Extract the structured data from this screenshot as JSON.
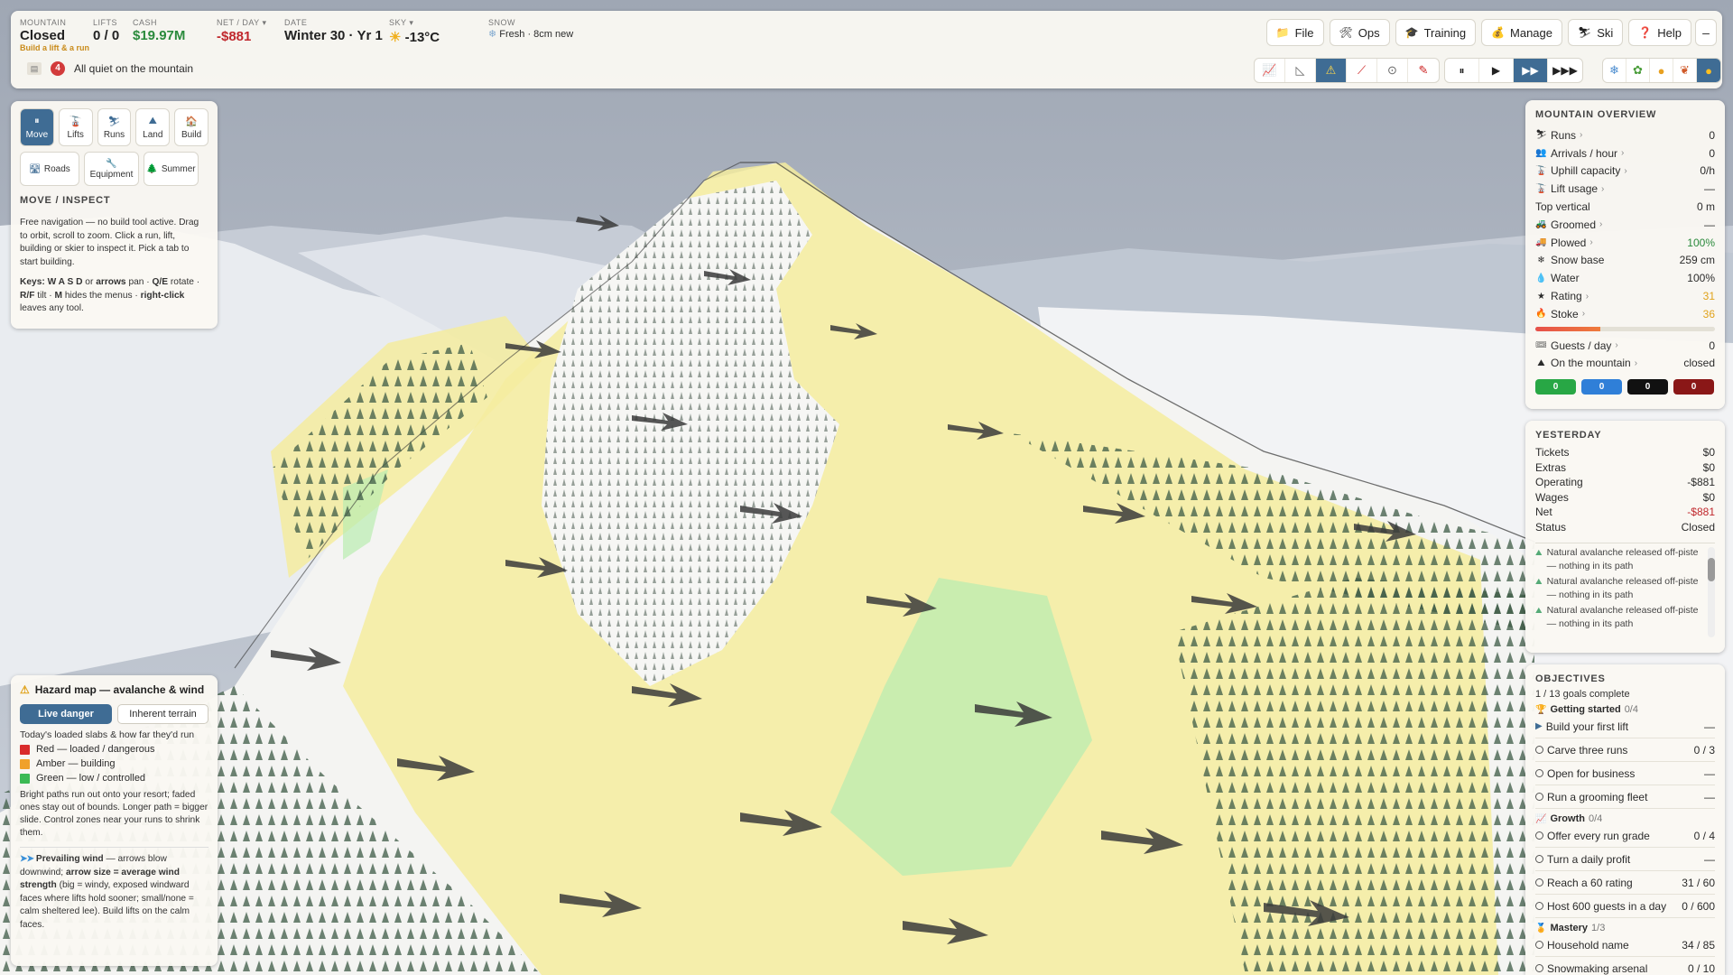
{
  "topbar": {
    "mountain_label": "MOUNTAIN",
    "mountain_value": "Closed",
    "mountain_sub": "Build a lift & a run",
    "lifts_label": "LIFTS",
    "lifts_value": "0 / 0",
    "cash_label": "CASH",
    "cash_value": "$19.97M",
    "net_label": "NET / DAY",
    "net_value": "-$881",
    "date_label": "DATE",
    "date_value": "Winter 30 · Yr 1",
    "sky_label": "SKY",
    "sky_value": "-13°C",
    "snow_label": "SNOW",
    "snow_value": "Fresh · 8cm new",
    "menu": [
      {
        "label": "File",
        "icon": "folder-icon",
        "glyph": "📁"
      },
      {
        "label": "Ops",
        "icon": "tools-icon",
        "glyph": "🛠"
      },
      {
        "label": "Training",
        "icon": "graduation-cap-icon",
        "glyph": "🎓"
      },
      {
        "label": "Manage",
        "icon": "money-bag-icon",
        "glyph": "💰"
      },
      {
        "label": "Ski",
        "icon": "skier-icon",
        "glyph": "⛷"
      },
      {
        "label": "Help",
        "icon": "question-icon",
        "glyph": "❓"
      }
    ],
    "collapse_glyph": "–",
    "ticker_count": "4",
    "ticker_text": "All quiet on the mountain"
  },
  "tools_panel": {
    "tabs": [
      {
        "label": "Move",
        "glyph": "⏸",
        "icon": "pause-icon"
      },
      {
        "label": "Lifts",
        "glyph": "🚡",
        "icon": "lift-icon"
      },
      {
        "label": "Runs",
        "glyph": "⛷",
        "icon": "skier-icon"
      },
      {
        "label": "Land",
        "glyph": "⛰",
        "icon": "mountain-icon"
      },
      {
        "label": "Build",
        "glyph": "🏠",
        "icon": "house-icon"
      }
    ],
    "tabs2": [
      {
        "label": "Roads",
        "glyph": "🛣",
        "icon": "road-icon"
      },
      {
        "label": "Equipment",
        "glyph": "🔧",
        "icon": "wrench-icon"
      },
      {
        "label": "Summer",
        "glyph": "🌲",
        "icon": "tree-icon"
      }
    ],
    "heading": "MOVE / INSPECT",
    "description": "Free navigation — no build tool active. Drag to orbit, scroll to zoom. Click a run, lift, building or skier to inspect it. Pick a tab to start building.",
    "keys_prefix": "Keys:",
    "keys_wasd": "W A S D",
    "keys_or": " or ",
    "keys_arrows": "arrows",
    "keys_pan": " pan · ",
    "keys_qe": "Q/E",
    "keys_rotate": " rotate · ",
    "keys_rf": "R/F",
    "keys_tilt": " tilt · ",
    "keys_m": "M",
    "keys_hides": " hides the menus · ",
    "keys_right": "right-click",
    "keys_leaves": " leaves any tool."
  },
  "hazard": {
    "title": "Hazard map — avalanche & wind",
    "toggle_live": "Live danger",
    "toggle_inherent": "Inherent terrain",
    "subtitle": "Today's loaded slabs & how far they'd run",
    "legend": [
      {
        "label": "Red — loaded / dangerous",
        "color": "#d92b2b"
      },
      {
        "label": "Amber — building",
        "color": "#f0a12a"
      },
      {
        "label": "Green — low / controlled",
        "color": "#3cba55"
      }
    ],
    "paragraph": "Bright paths run out onto your resort; faded ones stay out of bounds. Longer path = bigger slide. Control zones near your runs to shrink them.",
    "wind_glyph": "➤➤",
    "wind_bold": "Prevailing wind",
    "wind_text1": " — arrows blow downwind; ",
    "wind_bold2": "arrow size = average wind strength",
    "wind_text2": " (big = windy, exposed windward faces where lifts hold sooner; small/none = calm sheltered lee). Build lifts on the calm faces."
  },
  "overview": {
    "title": "MOUNTAIN OVERVIEW",
    "rows": [
      {
        "label": "Runs",
        "value": "0",
        "icon": "skier-icon",
        "glyph": "⛷",
        "chev": "›",
        "cls": ""
      },
      {
        "label": "Arrivals / hour",
        "value": "0",
        "icon": "people-icon",
        "glyph": "👥",
        "chev": "›",
        "cls": ""
      },
      {
        "label": "Uphill capacity",
        "value": "0/h",
        "icon": "lift-icon",
        "glyph": "🚡",
        "chev": "›",
        "cls": ""
      },
      {
        "label": "Lift usage",
        "value": "—",
        "icon": "lift-usage-icon",
        "glyph": "🚡",
        "chev": "›",
        "cls": ""
      },
      {
        "label": "Top vertical",
        "value": "0 m",
        "icon": "",
        "glyph": "",
        "chev": "",
        "cls": ""
      },
      {
        "label": "Groomed",
        "value": "—",
        "icon": "groomer-icon",
        "glyph": "🚜",
        "chev": "›",
        "cls": ""
      },
      {
        "label": "Plowed",
        "value": "100%",
        "icon": "plow-icon",
        "glyph": "🚚",
        "chev": "›",
        "cls": "green"
      },
      {
        "label": "Snow base",
        "value": "259 cm",
        "icon": "snowflake-icon",
        "glyph": "❄",
        "chev": "",
        "cls": ""
      },
      {
        "label": "Water",
        "value": "100%",
        "icon": "water-drop-icon",
        "glyph": "💧",
        "chev": "",
        "cls": ""
      },
      {
        "label": "Rating",
        "value": "31",
        "icon": "star-icon",
        "glyph": "★",
        "chev": "›",
        "cls": "amber"
      },
      {
        "label": "Stoke",
        "value": "36",
        "icon": "fire-icon",
        "glyph": "🔥",
        "chev": "›",
        "cls": "amber"
      }
    ],
    "stoke_level": 0.36,
    "rows2": [
      {
        "label": "Guests / day",
        "value": "0",
        "icon": "ticket-icon",
        "glyph": "🎟",
        "chev": "›"
      },
      {
        "label": "On the mountain",
        "value": "closed",
        "icon": "mountain-icon",
        "glyph": "⛰",
        "chev": "›"
      }
    ],
    "pills": [
      {
        "value": "0",
        "color": "#28a745",
        "name": "green-runs-pill"
      },
      {
        "value": "0",
        "color": "#2f7fd8",
        "name": "blue-runs-pill"
      },
      {
        "value": "0",
        "color": "#111111",
        "name": "black-runs-pill"
      },
      {
        "value": "0",
        "color": "#8a1717",
        "name": "double-black-runs-pill"
      }
    ]
  },
  "yesterday": {
    "title": "YESTERDAY",
    "rows": [
      {
        "label": "Tickets",
        "value": "$0",
        "cls": ""
      },
      {
        "label": "Extras",
        "value": "$0",
        "cls": ""
      },
      {
        "label": "Operating",
        "value": "-$881",
        "cls": ""
      },
      {
        "label": "Wages",
        "value": "$0",
        "cls": ""
      },
      {
        "label": "Net",
        "value": "-$881",
        "cls": "red"
      },
      {
        "label": "Status",
        "value": "Closed",
        "cls": ""
      }
    ],
    "log": [
      "Natural avalanche released off-piste — nothing in its path",
      "Natural avalanche released off-piste — nothing in its path",
      "Natural avalanche released off-piste — nothing in its path"
    ]
  },
  "objectives": {
    "title": "OBJECTIVES",
    "progress": "1 / 13 goals complete",
    "groups": [
      {
        "name": "Getting started",
        "count": "0/4",
        "glyph": "🏆",
        "items": [
          {
            "label": "Build your first lift",
            "value": "—",
            "active": true
          },
          {
            "label": "Carve three runs",
            "value": "0 / 3",
            "active": false
          },
          {
            "label": "Open for business",
            "value": "—",
            "active": false
          },
          {
            "label": "Run a grooming fleet",
            "value": "—",
            "active": false
          }
        ]
      },
      {
        "name": "Growth",
        "count": "0/4",
        "glyph": "📈",
        "items": [
          {
            "label": "Offer every run grade",
            "value": "0 / 4",
            "active": false
          },
          {
            "label": "Turn a daily profit",
            "value": "—",
            "active": false
          },
          {
            "label": "Reach a 60 rating",
            "value": "31 / 60",
            "active": false
          },
          {
            "label": "Host 600 guests in a day",
            "value": "0 / 600",
            "active": false
          }
        ]
      },
      {
        "name": "Mastery",
        "count": "1/3",
        "glyph": "🏅",
        "items": [
          {
            "label": "Household name",
            "value": "34 / 85",
            "active": false
          },
          {
            "label": "Snowmaking arsenal",
            "value": "0 / 10",
            "active": false
          }
        ]
      }
    ]
  }
}
